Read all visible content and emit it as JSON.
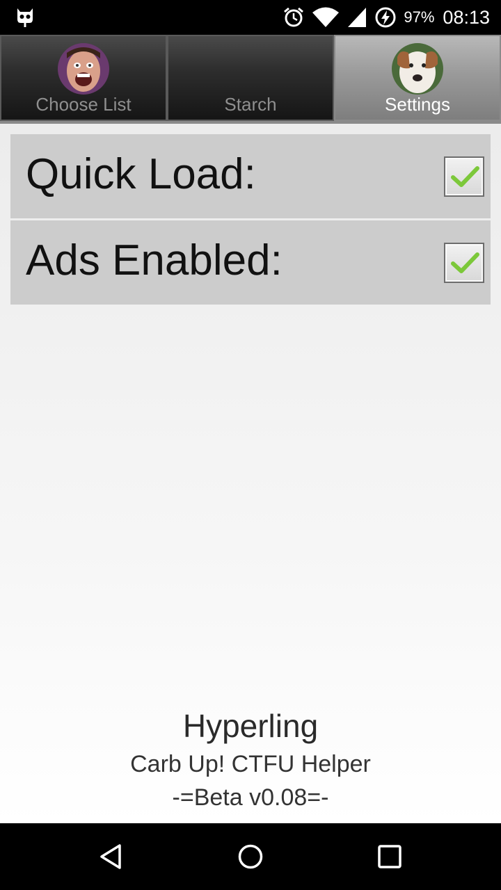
{
  "status_bar": {
    "battery_percent": "97%",
    "time": "08:13",
    "icons": [
      "cyanogen-robot-icon",
      "alarm-icon",
      "wifi-icon",
      "signal-icon",
      "battery-charging-icon"
    ]
  },
  "tabs": [
    {
      "label": "Choose List",
      "avatar": "face-avatar",
      "selected": false
    },
    {
      "label": "Starch",
      "avatar": null,
      "selected": false
    },
    {
      "label": "Settings",
      "avatar": "dog-avatar",
      "selected": true
    }
  ],
  "settings": [
    {
      "label": "Quick Load:",
      "checked": true
    },
    {
      "label": "Ads Enabled:",
      "checked": true
    }
  ],
  "footer": {
    "title": "Hyperling",
    "subtitle": "Carb Up! CTFU Helper",
    "version": "-=Beta v0.08=-"
  },
  "nav": {
    "icons": [
      "back-icon",
      "home-icon",
      "recents-icon"
    ]
  },
  "colors": {
    "accent_check": "#7cc83a",
    "row_bg": "#cccccc"
  }
}
